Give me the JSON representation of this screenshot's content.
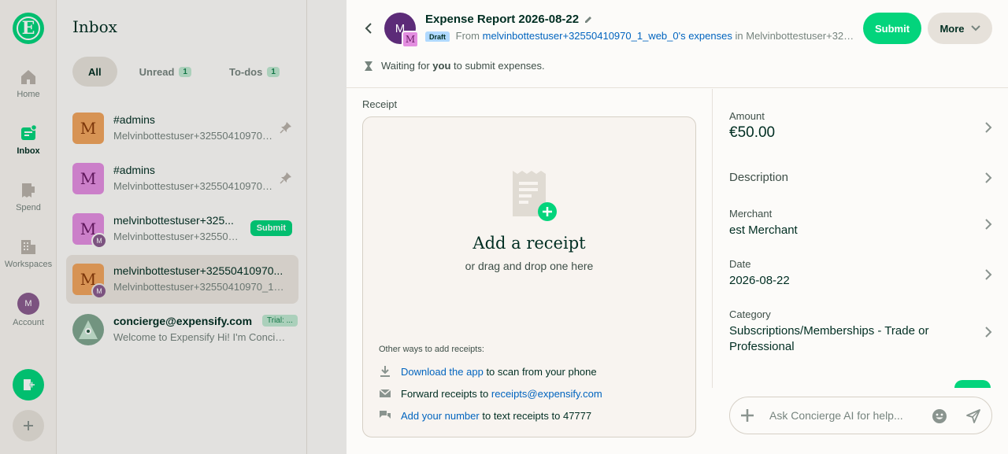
{
  "nav": {
    "logo_letter": "E",
    "items": [
      {
        "label": "Home",
        "icon": "home-icon"
      },
      {
        "label": "Inbox",
        "icon": "inbox-icon"
      },
      {
        "label": "Spend",
        "icon": "receipt-icon"
      },
      {
        "label": "Workspaces",
        "icon": "building-icon"
      },
      {
        "label": "Account",
        "icon": "avatar-icon"
      }
    ],
    "account_initial": "M"
  },
  "inbox": {
    "title": "Inbox",
    "filters": [
      {
        "label": "All",
        "count": ""
      },
      {
        "label": "Unread",
        "count": "1"
      },
      {
        "label": "To-dos",
        "count": "1"
      }
    ],
    "rows": [
      {
        "avatar": "M",
        "title": "#admins",
        "subtitle": "Melvinbottestuser+32550410970_...",
        "badge": ""
      },
      {
        "avatar": "M",
        "title": "#admins",
        "subtitle": "Melvinbottestuser+32550410970_...",
        "badge": ""
      },
      {
        "avatar": "M",
        "sub_avatar": "M",
        "title": "melvinbottestuser+325...",
        "subtitle": "Melvinbottestuser+3255041...",
        "badge": "Submit"
      },
      {
        "avatar": "M",
        "sub_avatar": "M",
        "title": "melvinbottestuser+32550410970...",
        "subtitle": "Melvinbottestuser+32550410970_1_we...",
        "badge": ""
      },
      {
        "avatar": "",
        "title": "concierge@expensify.com",
        "subtitle": "Welcome to Expensify Hi! I'm Concier...",
        "badge": "Trial: ..."
      }
    ]
  },
  "report": {
    "avatar": "M",
    "workspace_avatar": "M",
    "title": "Expense Report 2026-08-22",
    "status": "Draft",
    "from_prefix": "From",
    "from_link": "melvinbottestuser+32550410970_1_web_0's expenses",
    "in_prefix": "in",
    "in_text": "Melvinbottestuser+32550...",
    "submit_label": "Submit",
    "more_label": "More",
    "waiting_pre": "Waiting for",
    "waiting_bold": "you",
    "waiting_post": "to submit expenses."
  },
  "receipt": {
    "label": "Receipt",
    "title": "Add a receipt",
    "subtitle": "or drag and drop one here",
    "other_label": "Other ways to add receipts:",
    "ways": [
      {
        "link": "Download the app",
        "text": "to scan from your phone",
        "icon": "download-icon"
      },
      {
        "pre": "Forward receipts to",
        "link": "receipts@expensify.com",
        "icon": "mail-icon"
      },
      {
        "link": "Add your number",
        "text": "to text receipts to 47777",
        "icon": "chat-icon"
      }
    ]
  },
  "fields": {
    "amount": {
      "label": "Amount",
      "value": "€50.00"
    },
    "description": {
      "label": "Description",
      "value": ""
    },
    "merchant": {
      "label": "Merchant",
      "value": "est Merchant"
    },
    "date": {
      "label": "Date",
      "value": "2026-08-22"
    },
    "category": {
      "label": "Category",
      "value": "Subscriptions/Memberships - Trade or Professional"
    }
  },
  "composer": {
    "placeholder": "Ask Concierge AI for help..."
  },
  "colors": {
    "accent": "#03d47c",
    "link": "#0164bf",
    "text": "#002e22"
  }
}
